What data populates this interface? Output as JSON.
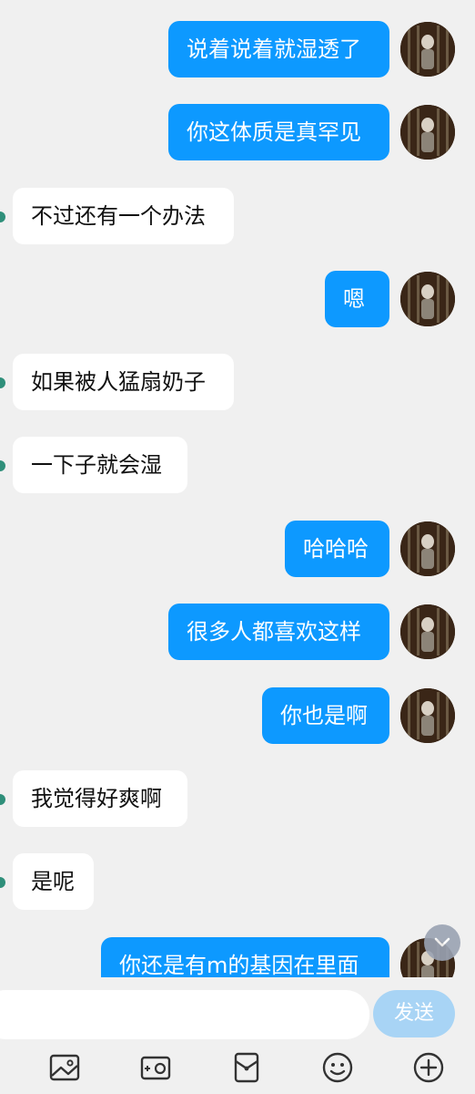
{
  "messages": [
    {
      "side": "out",
      "text": "说着说着就湿透了"
    },
    {
      "side": "out",
      "text": "你这体质是真罕见"
    },
    {
      "side": "in",
      "text": "不过还有一个办法"
    },
    {
      "side": "out",
      "text": "嗯"
    },
    {
      "side": "in",
      "text": "如果被人猛扇奶子"
    },
    {
      "side": "in",
      "text": "一下子就会湿"
    },
    {
      "side": "out",
      "text": "哈哈哈"
    },
    {
      "side": "out",
      "text": "很多人都喜欢这样"
    },
    {
      "side": "out",
      "text": "你也是啊"
    },
    {
      "side": "in",
      "text": "我觉得好爽啊"
    },
    {
      "side": "in",
      "text": "是呢"
    },
    {
      "side": "out",
      "text": "你还是有m的基因在里面"
    }
  ],
  "input": {
    "placeholder": "",
    "send_label": "发送"
  },
  "toolbar": {
    "icons": [
      "image-icon",
      "camera-icon",
      "red-packet-icon",
      "emoji-icon",
      "plus-icon"
    ]
  },
  "colors": {
    "outgoing_bubble": "#0d99ff",
    "incoming_bubble": "#ffffff",
    "background": "#f0f0f0",
    "send_button": "#a8d4f5"
  }
}
